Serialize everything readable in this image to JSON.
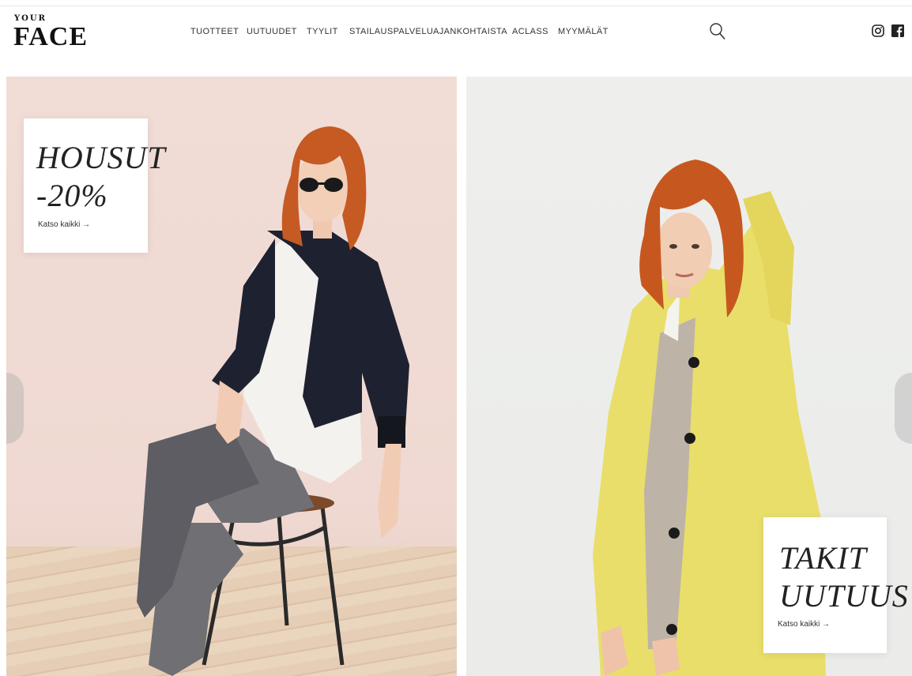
{
  "brand": {
    "small": "YOUR",
    "big": "FACE"
  },
  "nav": [
    {
      "label": "TUOTTEET"
    },
    {
      "label": "UUTUUDET"
    },
    {
      "label": "TYYLIT"
    },
    {
      "label": "STAILAUSPALVELU"
    },
    {
      "label": "AJANKOHTAISTA"
    },
    {
      "label": "ACLASS"
    },
    {
      "label": "MYYMÄLÄT"
    }
  ],
  "icons": {
    "search": "search-icon",
    "instagram": "instagram-icon",
    "facebook": "facebook-icon"
  },
  "banners": [
    {
      "title_line1": "HOUSUT",
      "title_line2": "-20%",
      "link": "Katso kaikki →"
    },
    {
      "title_line1": "TAKIT",
      "title_line2": "UUTUUS",
      "link": "Katso kaikki →"
    }
  ],
  "colors": {
    "accent_left_bg": "#f1dcd6",
    "accent_right_bg": "#ecedeb",
    "coat": "#e9de6a",
    "jacket": "#1e2230"
  }
}
